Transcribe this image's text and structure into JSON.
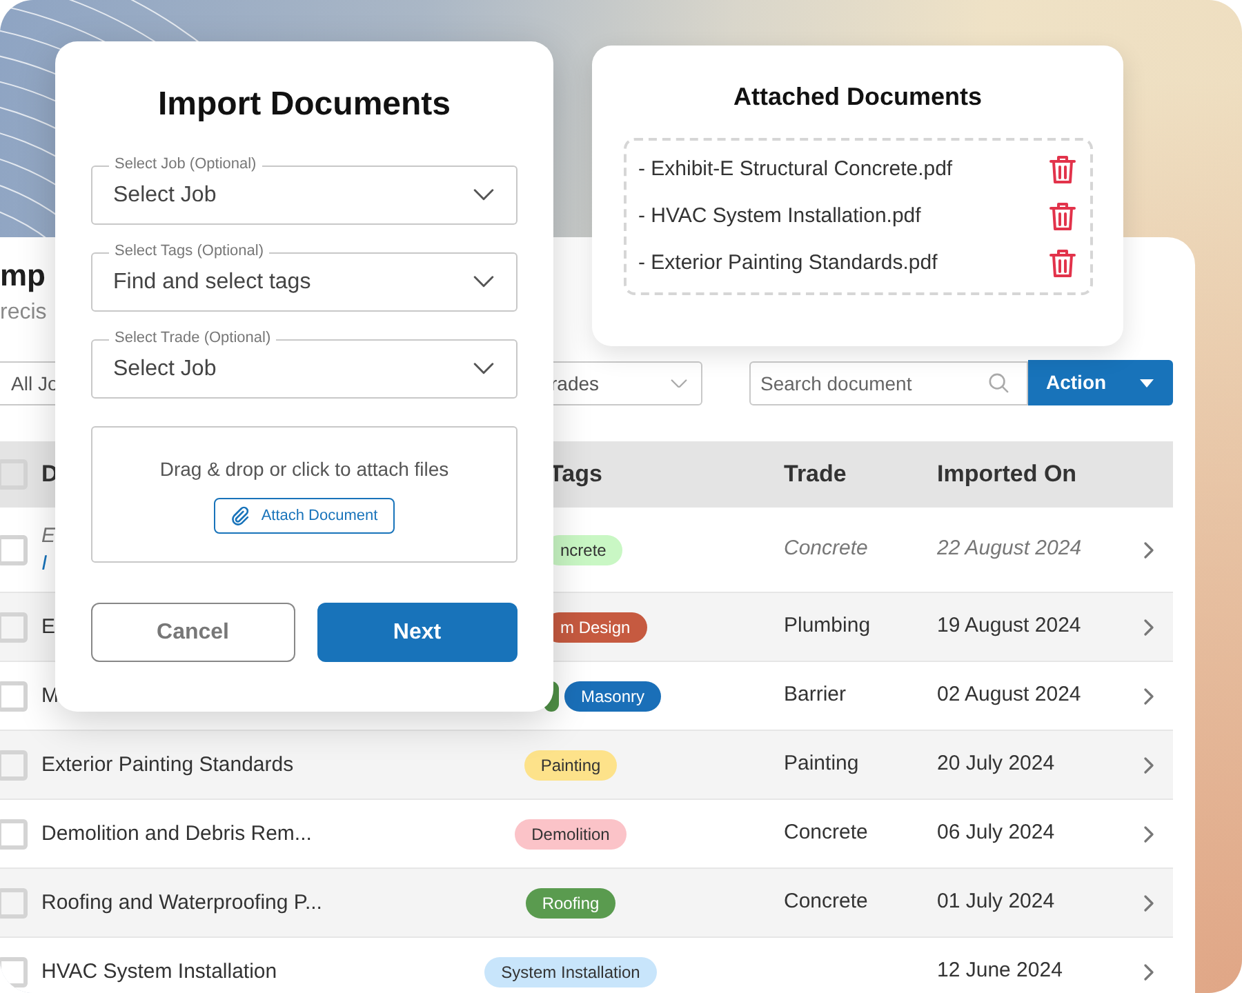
{
  "documents_page": {
    "title": "mp",
    "subtitle": "recis",
    "filters": [
      {
        "value": "All Jo"
      },
      {
        "value": "rades"
      }
    ],
    "search": {
      "placeholder": "Search document"
    },
    "action_button": "Action",
    "table": {
      "header_checked": false,
      "columns": [
        "D",
        "Tags",
        "Trade",
        "Imported On"
      ],
      "rows": [
        {
          "checked": false,
          "italic": true,
          "name": "E",
          "link": "I",
          "tags": [
            {
              "label": "ncrete",
              "color": "#c9f7c4"
            }
          ],
          "trade": "Concrete",
          "date": "22 August 2024"
        },
        {
          "checked": false,
          "italic": false,
          "name": "E",
          "tags": [
            {
              "label": "m Design",
              "color": "#c65a40"
            }
          ],
          "trade": "Plumbing",
          "date": "19 August 2024"
        },
        {
          "checked": false,
          "italic": false,
          "name": "M",
          "tags": [
            {
              "color": "#4f8f46"
            },
            {
              "label": "Masonry",
              "color": "#1a6fb8"
            }
          ],
          "trade": "Barrier",
          "date": "02 August 2024"
        },
        {
          "checked": false,
          "italic": false,
          "name": "Exterior Painting Standards",
          "tags": [
            {
              "label": "Painting",
              "color": "#fde28a"
            }
          ],
          "trade": "Painting",
          "date": "20 July 2024"
        },
        {
          "checked": false,
          "italic": false,
          "name": "Demolition and Debris Rem...",
          "tags": [
            {
              "label": "Demolition",
              "color": "#fbc3c8"
            }
          ],
          "trade": "Concrete",
          "date": "06 July 2024"
        },
        {
          "checked": false,
          "italic": false,
          "name": "Roofing and Waterproofing P...",
          "tags": [
            {
              "label": "Roofing",
              "color": "#5a9b4f"
            }
          ],
          "trade": "Concrete",
          "date": "01 July 2024"
        },
        {
          "checked": false,
          "italic": false,
          "name": "HVAC System Installation",
          "tags": [
            {
              "label": "System Installation",
              "color": "#c8e5fb"
            }
          ],
          "date": "12 June 2024"
        }
      ]
    }
  },
  "import_dialog": {
    "title": "Import Documents",
    "fields": [
      {
        "label": "Select Job (Optional)",
        "value": "Select Job"
      },
      {
        "label": "Select Tags (Optional)",
        "value": "Find and select tags"
      },
      {
        "label": "Select Trade (Optional)",
        "value": "Select Job"
      }
    ],
    "drop_zone": {
      "text": "Drag & drop or click to attach files",
      "button": "Attach Document"
    },
    "buttons": [
      "Cancel",
      "Next"
    ]
  },
  "attached_documents": {
    "title": "Attached Documents",
    "files": [
      "- Exhibit-E Structural Concrete.pdf",
      "- HVAC System Installation.pdf",
      "- Exterior Painting Standards.pdf"
    ]
  }
}
